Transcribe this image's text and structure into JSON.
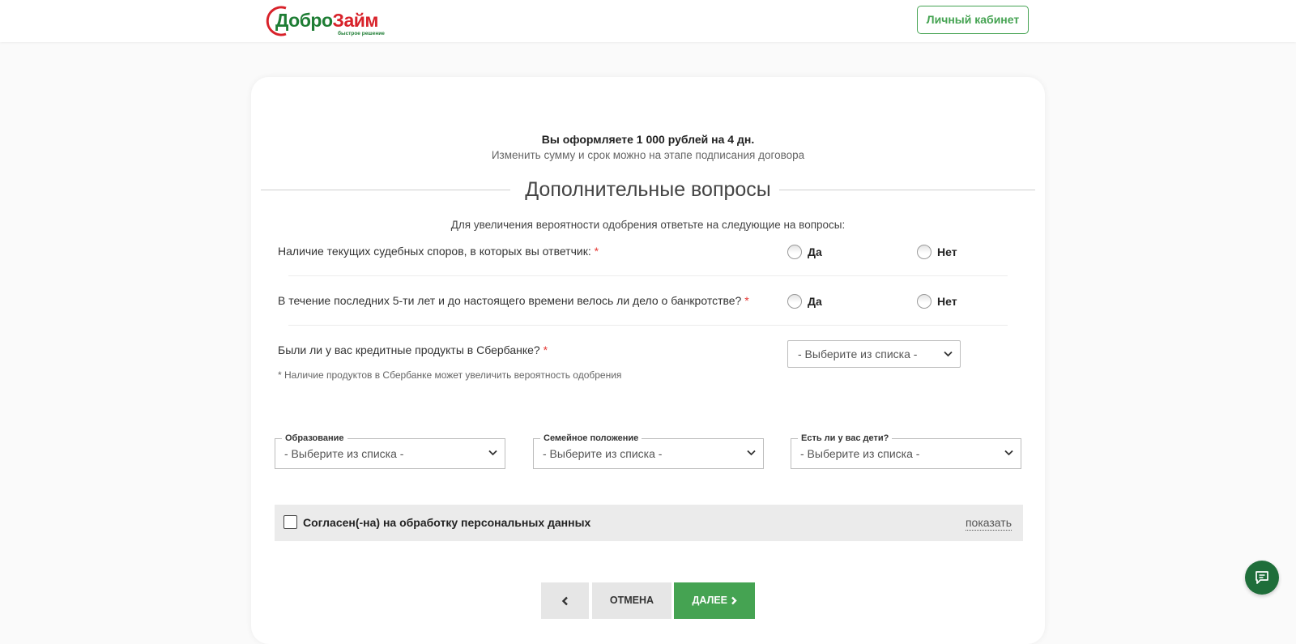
{
  "header": {
    "logo_part1": "Добро",
    "logo_part2": "Займ",
    "logo_tagline": "быстрое решение",
    "cabinet_label": "Личный кабинет"
  },
  "summary": {
    "title": "Вы оформляете 1 000 рублей на 4 дн.",
    "subtitle": "Изменить сумму и срок можно на этапе подписания договора"
  },
  "section": {
    "title": "Дополнительные вопросы",
    "intro": "Для увеличения вероятности одобрения ответьте на следующие на вопросы:"
  },
  "questions": [
    {
      "text": "Наличие текущих судебных споров, в которых вы ответчик:",
      "required_mark": "*",
      "yes_label": "Да",
      "no_label": "Нет"
    },
    {
      "text": "В течение последних 5-ти лет и до настоящего времени велось ли дело о банкротстве?",
      "required_mark": "*",
      "yes_label": "Да",
      "no_label": "Нет"
    },
    {
      "text": "Были ли у вас кредитные продукты в Сбербанке?",
      "required_mark": "*",
      "select_value": "- Выберите из списка -"
    }
  ],
  "hint": "* Наличие продуктов в Сбербанке может увеличить вероятность одобрения",
  "fields": [
    {
      "label": "Образование",
      "value": "- Выберите из списка -"
    },
    {
      "label": "Семейное положение",
      "value": "- Выберите из списка -"
    },
    {
      "label": "Есть ли у вас дети?",
      "value": "- Выберите из списка -"
    }
  ],
  "consent": {
    "label": "Согласен(-на) на обработку персональных данных",
    "checked": false,
    "show_label": "показать"
  },
  "buttons": {
    "cancel_label": "ОТМЕНА",
    "next_label": "ДАЛЕЕ"
  },
  "colors": {
    "brand_green": "#45a352",
    "logo_red": "#d8222a",
    "chat_button": "#1f6e3a"
  }
}
